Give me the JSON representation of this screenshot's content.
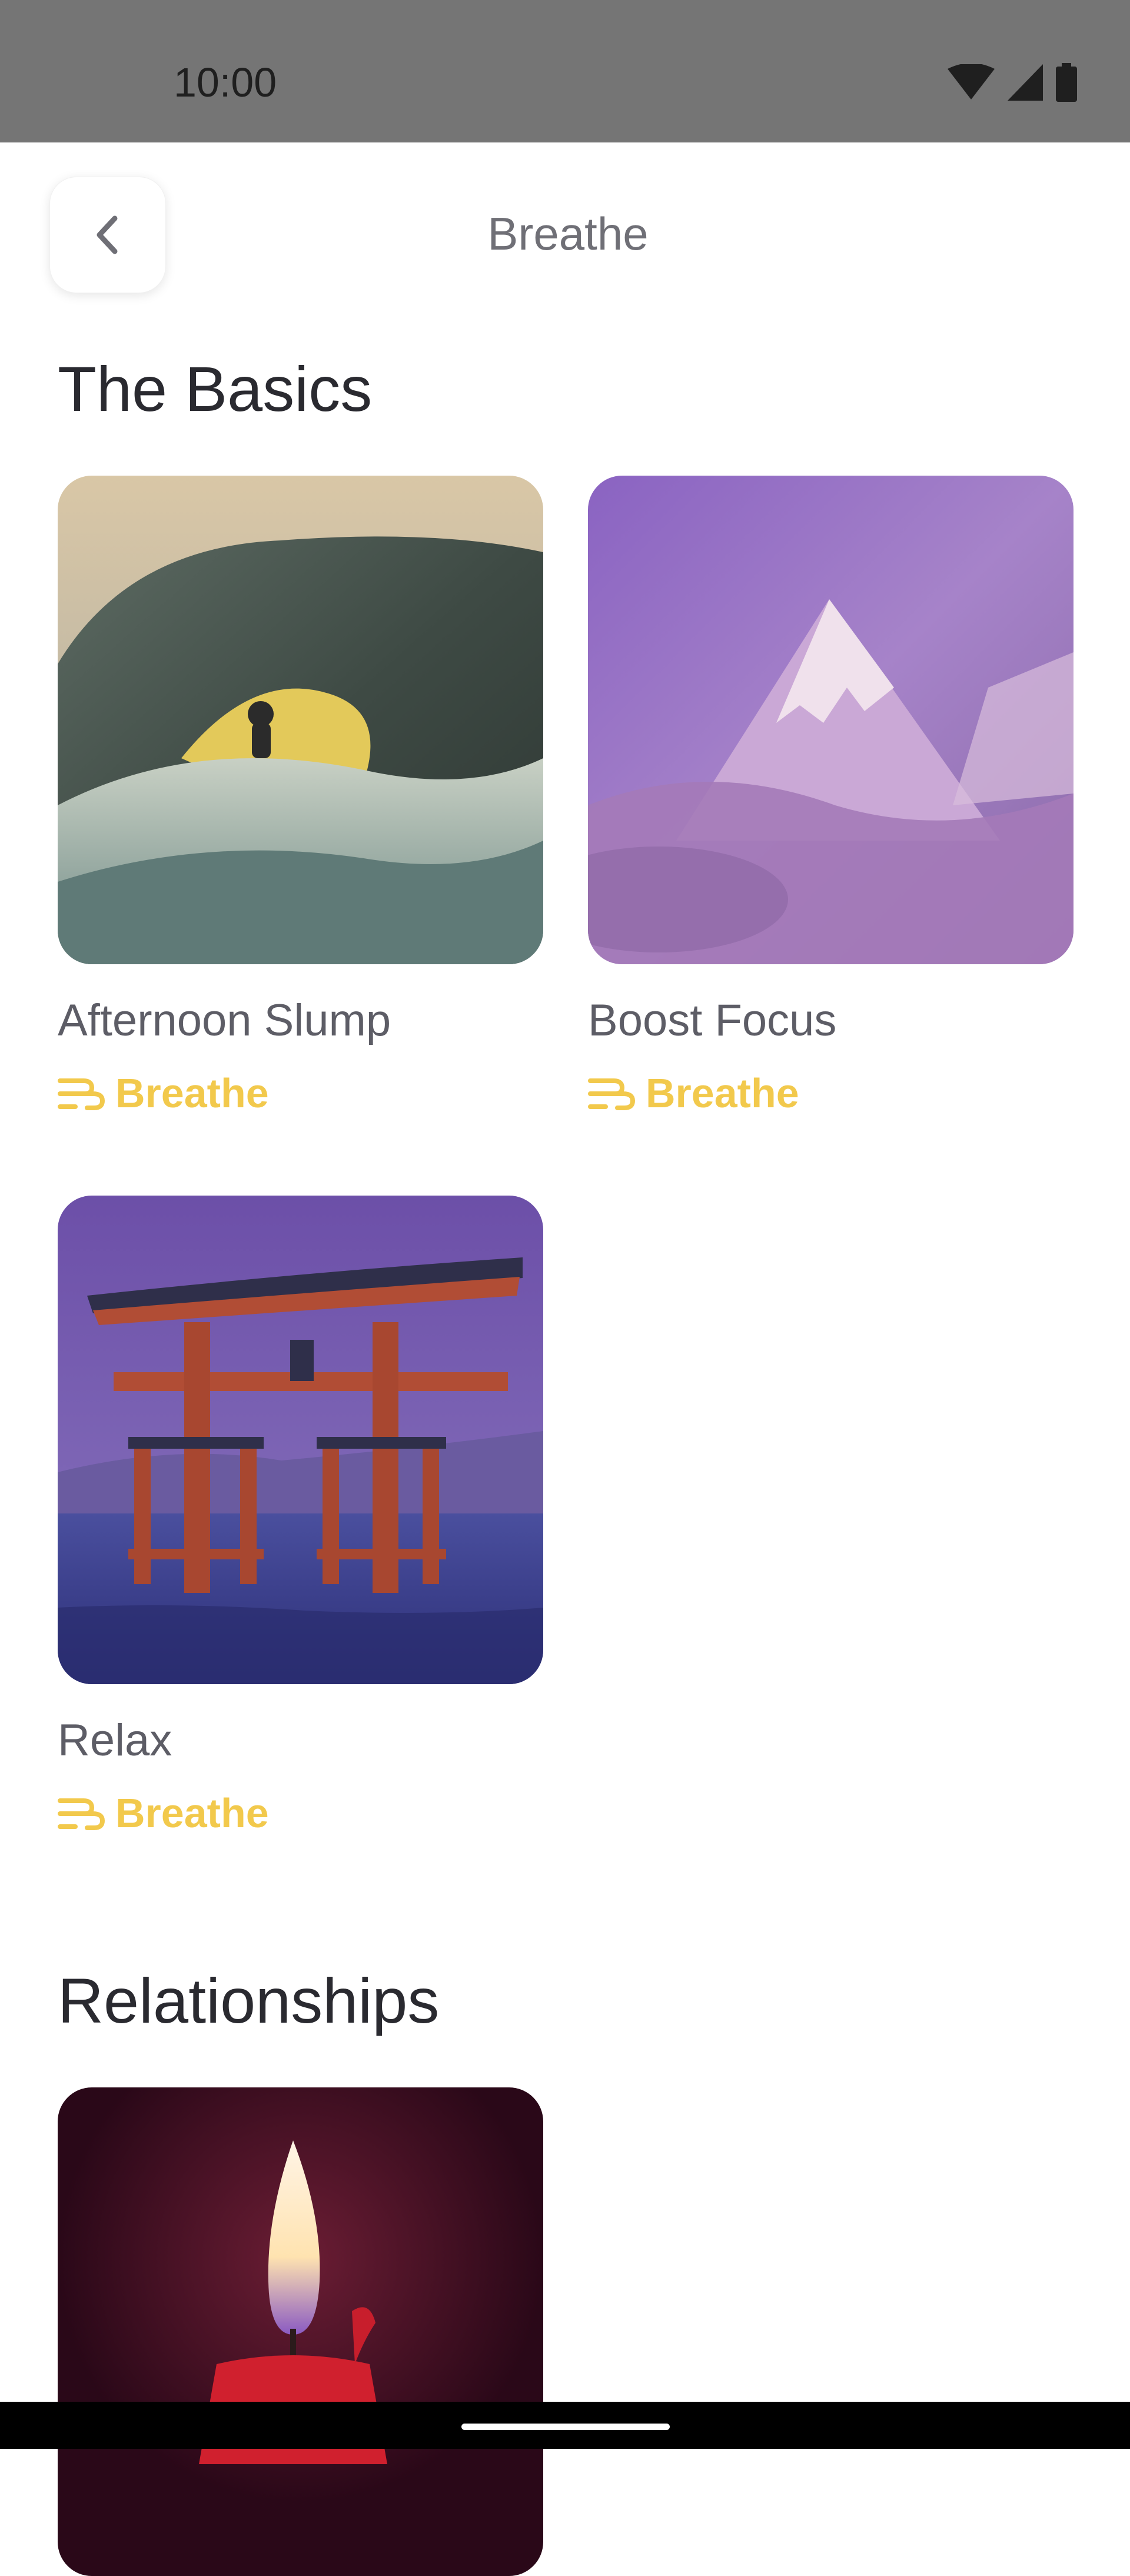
{
  "status_bar": {
    "time": "10:00",
    "icons": [
      "wifi-icon",
      "cell-signal-icon",
      "battery-icon"
    ]
  },
  "header": {
    "title": "Breathe",
    "back_icon": "chevron-left-icon"
  },
  "sections": [
    {
      "heading": "The Basics",
      "cards": [
        {
          "title": "Afternoon Slump",
          "tag": "Breathe",
          "image": "ocean wave with surfer"
        },
        {
          "title": "Boost Focus",
          "tag": "Breathe",
          "image": "purple mountain peak"
        },
        {
          "title": "Relax",
          "tag": "Breathe",
          "image": "torii gate in water at dusk"
        }
      ]
    },
    {
      "heading": "Relationships",
      "cards": [
        {
          "title": "",
          "tag": "",
          "image": "red candle flame"
        }
      ]
    }
  ],
  "colors": {
    "status_bar": "#757575",
    "tag_accent": "#f2c94c",
    "heading": "#2a2a30",
    "card_title": "#5d5d66"
  }
}
